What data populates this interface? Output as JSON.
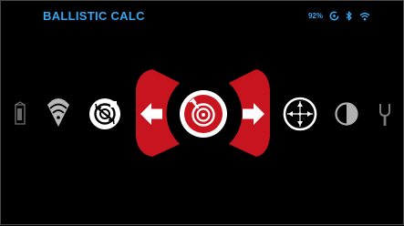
{
  "header": {
    "title": "BALLISTIC CALC"
  },
  "status_bar": {
    "battery_percent": "92%",
    "icons": [
      "battery-ring-icon",
      "bluetooth-icon",
      "wifi-icon"
    ]
  },
  "carousel": {
    "items": [
      {
        "name": "document-icon",
        "state": "faded"
      },
      {
        "name": "wifi-icon",
        "state": "dim"
      },
      {
        "name": "target-refresh-icon",
        "state": "normal"
      },
      {
        "name": "arrow-left-icon",
        "state": "nav"
      },
      {
        "name": "ballistic-calc-icon",
        "state": "selected"
      },
      {
        "name": "arrow-right-icon",
        "state": "nav"
      },
      {
        "name": "reticle-icon",
        "state": "normal"
      },
      {
        "name": "contrast-icon",
        "state": "dim"
      },
      {
        "name": "tuning-fork-icon",
        "state": "faded"
      }
    ]
  },
  "colors": {
    "accent_blue": "#3aa6f0",
    "selection_red": "#c8141e",
    "icon_white": "#ffffff",
    "background": "#000000"
  }
}
